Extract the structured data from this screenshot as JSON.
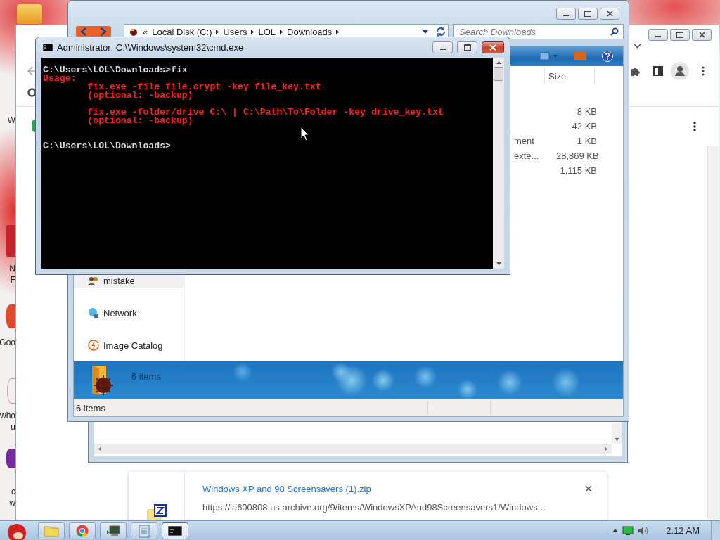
{
  "desktop": {
    "icon_labels": [
      {
        "text": "W"
      },
      {
        "text": "N"
      },
      {
        "text": "F"
      },
      {
        "text": "Goo"
      },
      {
        "text": "who"
      },
      {
        "text": "u"
      },
      {
        "text": "c"
      },
      {
        "text": "w"
      }
    ]
  },
  "browser": {
    "download": {
      "file_name": "Windows XP and 98 Screensavers (1).zip",
      "url": "https://ia600808.us.archive.org/9/items/WindowsXPAnd98Screensavers1/Windows..."
    }
  },
  "explorer": {
    "breadcrumb": [
      "«",
      "Local Disk (C:)",
      "Users",
      "LOL",
      "Downloads"
    ],
    "search": {
      "placeholder": "Search Downloads"
    },
    "columns": [
      "Size"
    ],
    "rows": [
      {
        "size": "8 KB"
      },
      {
        "size": "42 KB"
      },
      {
        "type": "ment",
        "size": "1 KB"
      },
      {
        "type": "exte...",
        "size": "28,869 KB"
      },
      {
        "size": "1,115 KB"
      }
    ],
    "nav_items": [
      {
        "label": "mistake",
        "kind": "user",
        "selected": true
      },
      {
        "label": "Network",
        "kind": "network",
        "selected": false
      },
      {
        "label": "Image Catalog",
        "kind": "catalog",
        "selected": false
      }
    ],
    "details": {
      "count": "6 items"
    },
    "status_bar": "6 items"
  },
  "console": {
    "title": "Administrator: C:\\Windows\\system32\\cmd.exe",
    "lines": [
      {
        "kind": "input",
        "text": "C:\\Users\\LOL\\Downloads>fix"
      },
      {
        "kind": "error",
        "text": "Usage:"
      },
      {
        "kind": "error",
        "text": "        fix.exe -file file.crypt -key file_key.txt"
      },
      {
        "kind": "error",
        "text": "        (optional: -backup)"
      },
      {
        "kind": "blank"
      },
      {
        "kind": "error",
        "text": "        fix.exe -folder/drive C:\\ | C:\\Path\\To\\Folder -key drive_key.txt"
      },
      {
        "kind": "error",
        "text": "        (optional: -backup)"
      },
      {
        "kind": "blank"
      },
      {
        "kind": "blank"
      },
      {
        "kind": "input",
        "text": "C:\\Users\\LOL\\Downloads>"
      }
    ]
  },
  "taskbar": {
    "buttons": [
      {
        "kind": "folder",
        "selected": false
      },
      {
        "kind": "browser",
        "selected": false
      },
      {
        "kind": "app",
        "selected": false
      },
      {
        "kind": "notepad",
        "selected": false
      },
      {
        "kind": "console",
        "selected": true
      }
    ],
    "clock": "2:12 AM"
  }
}
